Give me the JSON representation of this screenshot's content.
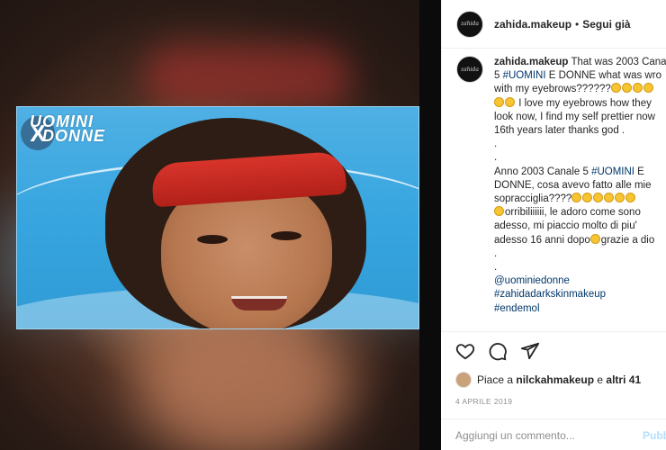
{
  "post_header": {
    "username": "zahida.makeup",
    "separator": "•",
    "follow_label": "Segui già",
    "avatar_text": "zahida"
  },
  "media": {
    "logo_text_line1": "UOMINI",
    "logo_text_line2": "DONNE",
    "logo_badge": "X"
  },
  "caption": {
    "username": "zahida.makeup",
    "text_line1_after_user": "That was 2003 Cana",
    "text_line2_pre": "5 ",
    "hashtag1": "#UOMINI",
    "text_line2_post": " E DONNE what was wro",
    "text_line3": "with my eyebrows??????",
    "text_line4": " I love my eyebrows how they",
    "text_line5": "look now, I find my self prettier now",
    "text_line6": "16th years later thanks god .",
    "dot1": ".",
    "dot2": ".",
    "it_line1_pre": "Anno 2003 Canale 5 ",
    "hashtag2": "#UOMINI",
    "it_line1_post": " E",
    "it_line2": "DONNE, cosa avevo fatto alle mie",
    "it_line3": "sopracciglia????",
    "it_line4": "orribiliiiiii, le adoro come sono",
    "it_line5": "adesso, mi piaccio molto di piu'",
    "it_line6_pre": "adesso 16 anni dopo",
    "it_line6_post": "grazie a dio",
    "dot3": ".",
    "dot4": ".",
    "mention": "@uominiedonne",
    "tag_a": "#zahidadarkskinmakeup",
    "tag_b": "#endemol"
  },
  "actions": {
    "like_icon": "heart-icon",
    "comment_icon": "comment-icon",
    "share_icon": "share-icon",
    "likes_prefix": "Piace a ",
    "likes_user": "nilckahmakeup",
    "likes_mid": " e ",
    "likes_others": "altri 41",
    "date": "4 APRILE 2019"
  },
  "comment_box": {
    "placeholder": "Aggiungi un commento...",
    "post_label": "Pubb"
  }
}
